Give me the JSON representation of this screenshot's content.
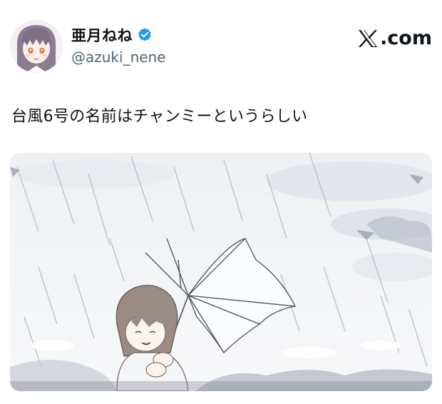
{
  "author": {
    "display_name": "亜月ねね",
    "handle": "@azuki_nene",
    "verified": true,
    "verified_icon": "verified-badge-icon",
    "avatar_icon": "avatar-illustration"
  },
  "source": {
    "logo_icon": "x-logo-icon",
    "label": ".com"
  },
  "tweet": {
    "text": "台風6号の名前はチャンミーというらしい"
  },
  "media": {
    "image_icon": "illustration-girl-broken-umbrella-in-storm"
  },
  "colors": {
    "text_primary": "#0f1419",
    "text_secondary": "#536471",
    "verified_blue": "#1d9bf0",
    "background": "#ffffff"
  }
}
